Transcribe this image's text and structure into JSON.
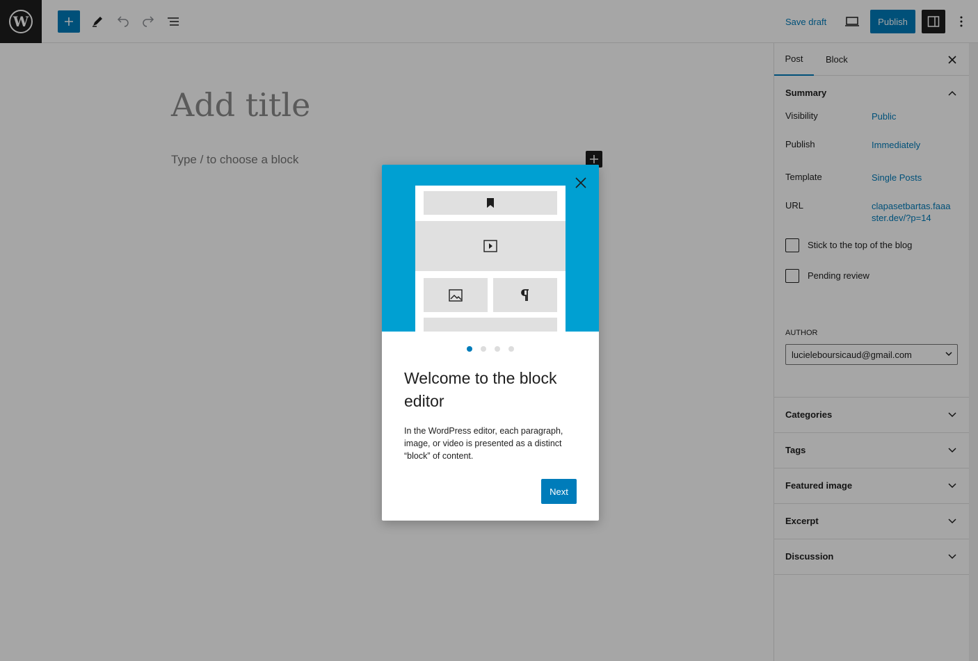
{
  "toolbar": {
    "logo_icon": "wordpress-logo",
    "save_draft_label": "Save draft",
    "publish_label": "Publish"
  },
  "canvas": {
    "title_placeholder": "Add title",
    "paragraph_placeholder": "Type / to choose a block"
  },
  "sidebar": {
    "tabs": [
      {
        "label": "Post",
        "active": true
      },
      {
        "label": "Block",
        "active": false
      }
    ],
    "summary": {
      "heading": "Summary",
      "rows": [
        {
          "label": "Visibility",
          "value": "Public"
        },
        {
          "label": "Publish",
          "value": "Immediately"
        },
        {
          "label": "Template",
          "value": "Single Posts"
        },
        {
          "label": "URL",
          "value": "clapasetbartas.faaaster.dev/?p=14"
        }
      ],
      "checkboxes": [
        {
          "label": "Stick to the top of the blog",
          "checked": false
        },
        {
          "label": "Pending review",
          "checked": false
        }
      ],
      "author_label": "AUTHOR",
      "author_value": "lucieleboursicaud@gmail.com"
    },
    "panels": [
      {
        "label": "Categories"
      },
      {
        "label": "Tags"
      },
      {
        "label": "Featured image"
      },
      {
        "label": "Excerpt"
      },
      {
        "label": "Discussion"
      }
    ]
  },
  "guide": {
    "title": "Welcome to the block editor",
    "text": "In the WordPress editor, each paragraph, image, or video is presented as a distinct “block” of content.",
    "next_label": "Next",
    "page_count": 4,
    "current_page": 1
  },
  "colors": {
    "accent": "#007cba",
    "hero": "#00a0d2",
    "dark": "#1e1e1e"
  }
}
